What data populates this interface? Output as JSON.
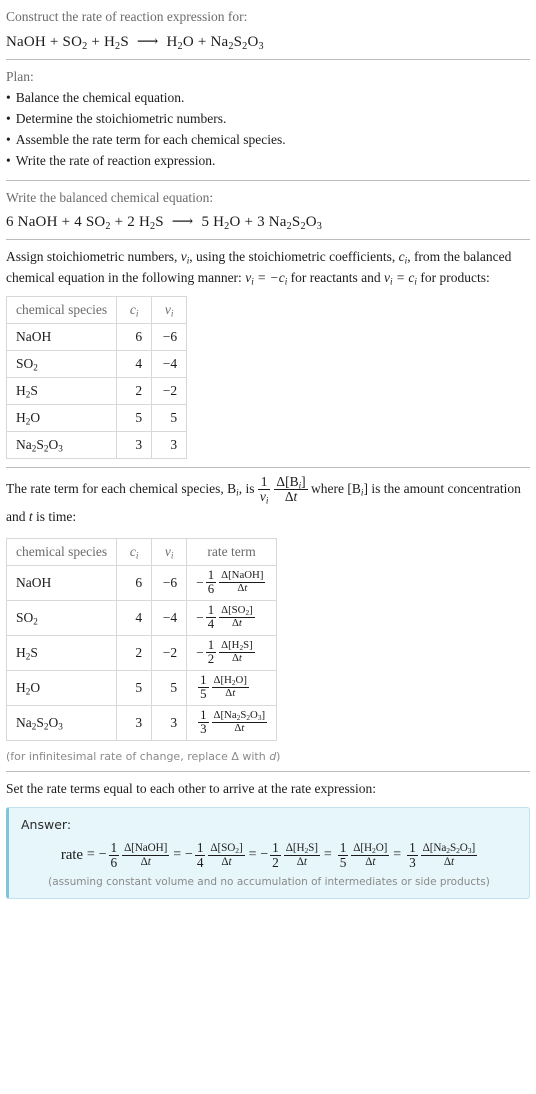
{
  "prompt": {
    "label": "Construct the rate of reaction expression for:",
    "equation": {
      "reactants": [
        "NaOH",
        "SO_2",
        "H_2S"
      ],
      "products": [
        "H_2O",
        "Na_2S_2O_3"
      ],
      "arrow": "⟶",
      "display": "NaOH + SO2 + H2S ⟶ H2O + Na2S2O3"
    }
  },
  "plan": {
    "label": "Plan:",
    "steps": [
      "Balance the chemical equation.",
      "Determine the stoichiometric numbers.",
      "Assemble the rate term for each chemical species.",
      "Write the rate of reaction expression."
    ]
  },
  "balanced": {
    "label": "Write the balanced chemical equation:",
    "display": "6 NaOH + 4 SO2 + 2 H2S ⟶ 5 H2O + 3 Na2S2O3",
    "reactant_coefficients": [
      6,
      4,
      2
    ],
    "product_coefficients": [
      5,
      3
    ]
  },
  "assign": {
    "text_1": "Assign stoichiometric numbers, ",
    "text_2": ", using the stoichiometric coefficients, ",
    "text_3": ", from the balanced chemical equation in the following manner: ",
    "text_4": " for reactants and ",
    "text_5": " for products:",
    "nu_i": "ν_i",
    "c_i": "c_i",
    "rule_reactants": "ν_i = −c_i",
    "rule_products": "ν_i = c_i"
  },
  "stoich_table": {
    "headers": [
      "chemical species",
      "c_i",
      "ν_i"
    ],
    "rows": [
      {
        "species": "NaOH",
        "c": "6",
        "nu": "−6"
      },
      {
        "species": "SO_2",
        "c": "4",
        "nu": "−4"
      },
      {
        "species": "H_2S",
        "c": "2",
        "nu": "−2"
      },
      {
        "species": "H_2O",
        "c": "5",
        "nu": "5"
      },
      {
        "species": "Na_2S_2O_3",
        "c": "3",
        "nu": "3"
      }
    ]
  },
  "rateterm_intro": {
    "text_1": "The rate term for each chemical species, ",
    "b_i": "B_i",
    "text_2": ", is ",
    "formula": "(1/ν_i)(Δ[B_i]/Δt)",
    "text_3": " where ",
    "bracket_b_i": "[B_i]",
    "text_4": " is the amount concentration and ",
    "t": "t",
    "text_5": " is time:"
  },
  "rate_table": {
    "headers": [
      "chemical species",
      "c_i",
      "ν_i",
      "rate term"
    ],
    "rows": [
      {
        "species": "NaOH",
        "c": "6",
        "nu": "−6",
        "sign": "−",
        "denom": "1",
        "over": "6",
        "numerator": "Δ[NaOH]",
        "denominator": "Δt"
      },
      {
        "species": "SO_2",
        "c": "4",
        "nu": "−4",
        "sign": "−",
        "denom": "1",
        "over": "4",
        "numerator": "Δ[SO_2]",
        "denominator": "Δt"
      },
      {
        "species": "H_2S",
        "c": "2",
        "nu": "−2",
        "sign": "−",
        "denom": "1",
        "over": "2",
        "numerator": "Δ[H_2S]",
        "denominator": "Δt"
      },
      {
        "species": "H_2O",
        "c": "5",
        "nu": "5",
        "sign": "",
        "denom": "1",
        "over": "5",
        "numerator": "Δ[H_2O]",
        "denominator": "Δt"
      },
      {
        "species": "Na_2S_2O_3",
        "c": "3",
        "nu": "3",
        "sign": "",
        "denom": "1",
        "over": "3",
        "numerator": "Δ[Na_2S_2O_3]",
        "denominator": "Δt"
      }
    ],
    "footnote": "(for infinitesimal rate of change, replace Δ with d)"
  },
  "conclusion": {
    "label": "Set the rate terms equal to each other to arrive at the rate expression:"
  },
  "answer": {
    "title": "Answer:",
    "rate_label": "rate",
    "terms": [
      {
        "sign": "−",
        "num": "1",
        "den": "6",
        "species": "NaOH"
      },
      {
        "sign": "−",
        "num": "1",
        "den": "4",
        "species": "SO_2"
      },
      {
        "sign": "−",
        "num": "1",
        "den": "2",
        "species": "H_2S"
      },
      {
        "sign": "",
        "num": "1",
        "den": "5",
        "species": "H_2O"
      },
      {
        "sign": "",
        "num": "1",
        "den": "3",
        "species": "Na_2S_2O_3"
      }
    ],
    "note": "(assuming constant volume and no accumulation of intermediates or side products)",
    "background": "#e7f6fb",
    "accent": "#7fc4dc"
  }
}
